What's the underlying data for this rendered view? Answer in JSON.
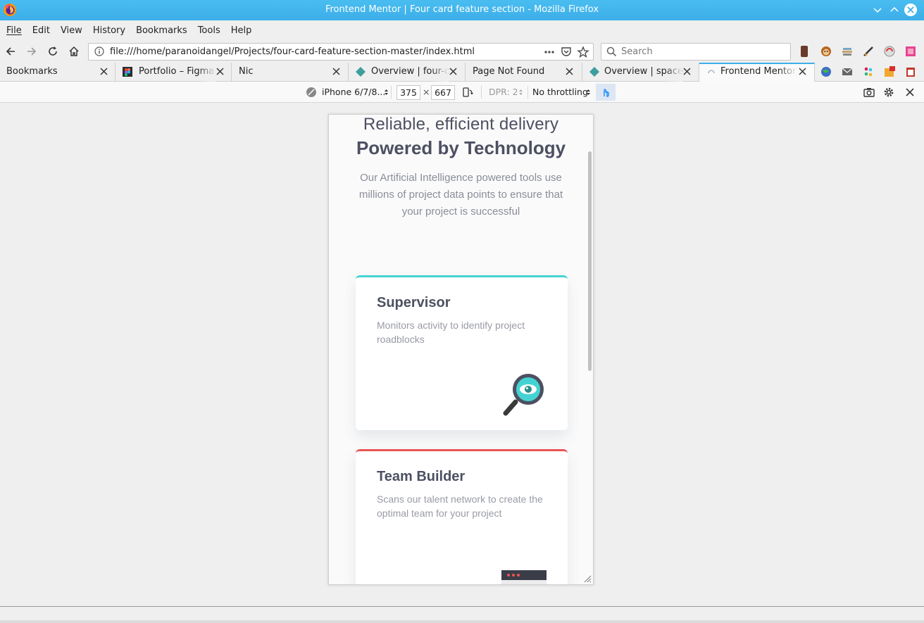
{
  "window": {
    "title": "Frontend Mentor | Four card feature section - Mozilla Firefox"
  },
  "menu": [
    {
      "accel": "F",
      "rest": "ile"
    },
    {
      "accel": "E",
      "rest": "dit"
    },
    {
      "accel": "V",
      "rest": "iew"
    },
    {
      "accel": "",
      "pre": "Hi",
      "accel2": "s",
      "rest": "tory"
    },
    {
      "accel": "B",
      "rest": "ookmarks"
    },
    {
      "accel": "T",
      "rest": "ools"
    },
    {
      "accel": "H",
      "rest": "elp"
    }
  ],
  "menu_labels": {
    "file": "File",
    "edit": "Edit",
    "view": "View",
    "history": "History",
    "bookmarks": "Bookmarks",
    "tools": "Tools",
    "help": "Help"
  },
  "urlbar": {
    "url": "file:///home/paranoidangel/Projects/four-card-feature-section-master/index.html"
  },
  "search": {
    "placeholder": "Search"
  },
  "tabs": [
    {
      "label": "Bookmarks",
      "favicon": "none"
    },
    {
      "label": "Portfolio – Figma",
      "favicon": "figma-icon"
    },
    {
      "label": "Nic",
      "favicon": "none"
    },
    {
      "label": "Overview | four-c",
      "favicon": "frontend-mentor-icon"
    },
    {
      "label": "Page Not Found",
      "favicon": "none"
    },
    {
      "label": "Overview | space",
      "favicon": "frontend-mentor-icon"
    },
    {
      "label": "Frontend Mentor",
      "favicon": "loading-icon",
      "active": true
    }
  ],
  "rdm": {
    "device": "iPhone 6/7/8...",
    "width": "375",
    "times": "×",
    "height": "667",
    "dpr": "DPR: 2",
    "throttling": "No throttling"
  },
  "page": {
    "heading_light": "Reliable, efficient delivery",
    "heading_bold": "Powered by Technology",
    "intro": "Our Artificial Intelligence powered tools use millions of project data points to ensure that your project is successful",
    "cards": [
      {
        "title": "Supervisor",
        "description": "Monitors activity to identify project roadblocks",
        "accent": "#44d3d2",
        "icon": "supervisor-icon"
      },
      {
        "title": "Team Builder",
        "description": "Scans our talent network to create the optimal team for your project",
        "accent": "#ea5454",
        "icon": "team-builder-icon"
      }
    ]
  },
  "colors": {
    "titlebar": "#3daee9",
    "cyan": "#44d3d2",
    "red": "#ea5454",
    "heading": "#4d5061",
    "body_text": "#999ba6"
  }
}
